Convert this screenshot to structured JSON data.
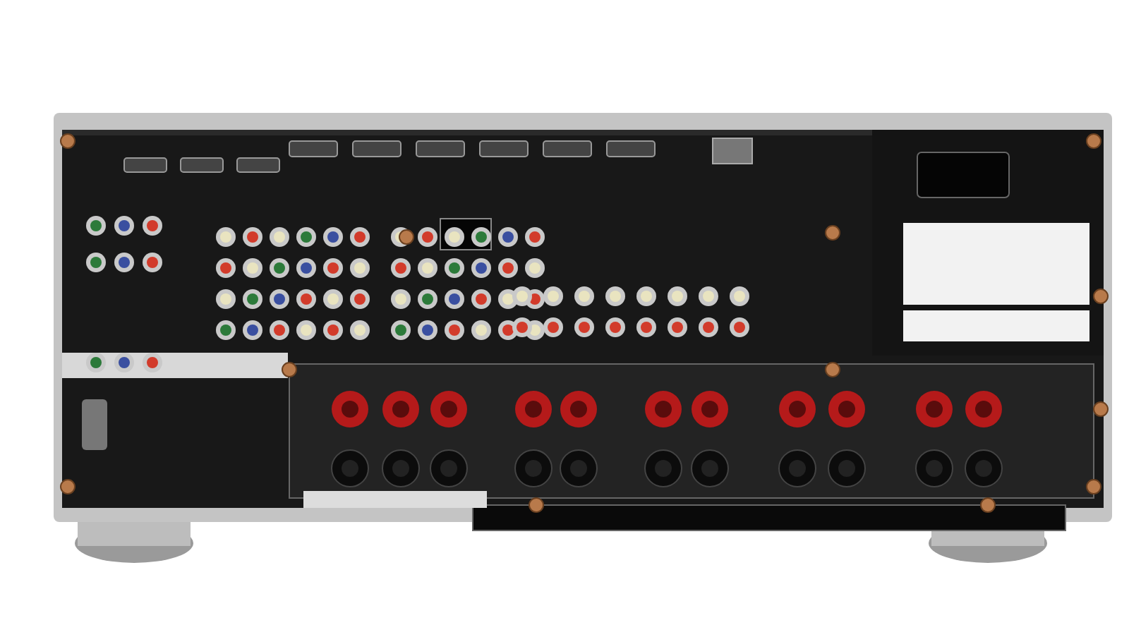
{
  "photo": {
    "kind": "product-photo"
  }
}
